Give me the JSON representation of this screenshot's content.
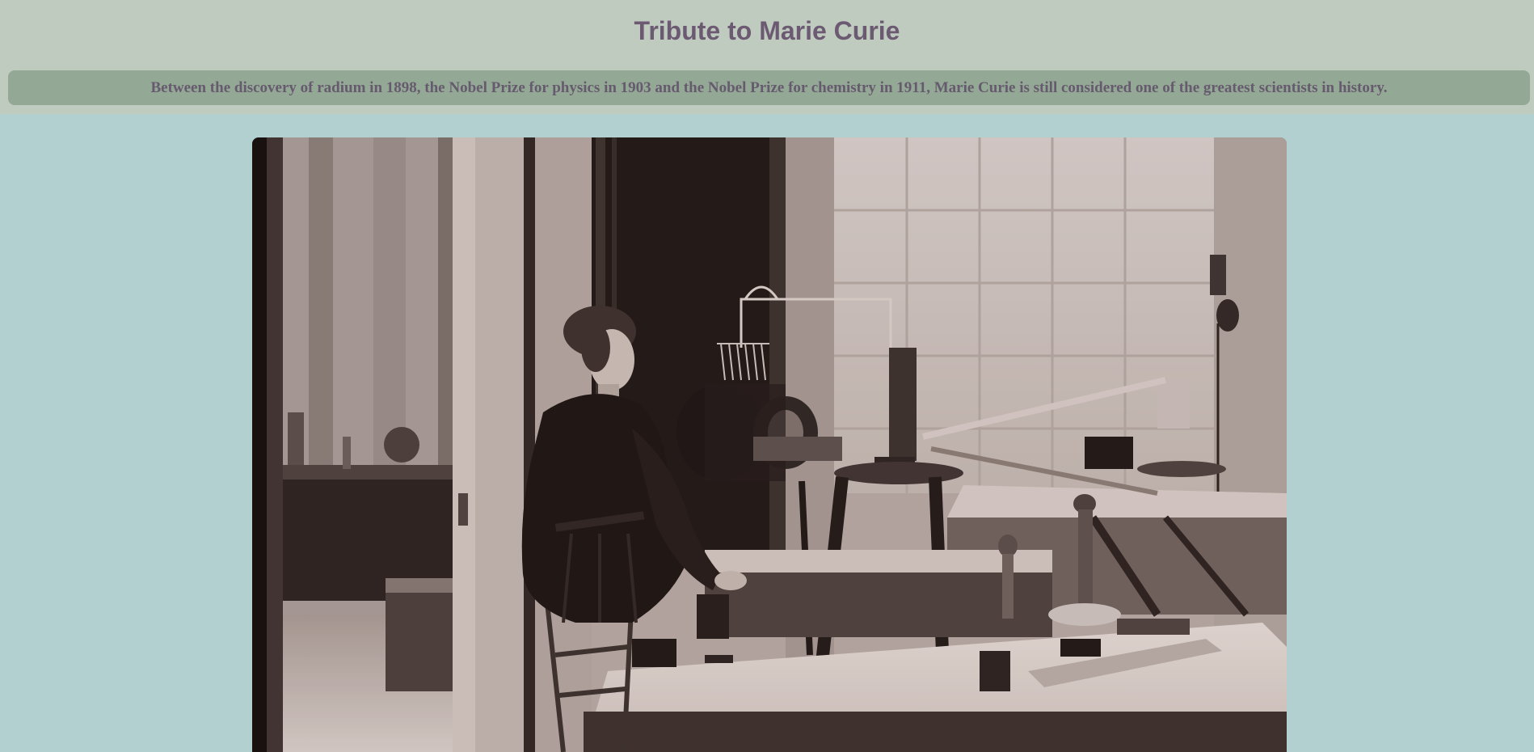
{
  "page": {
    "title": "Tribute to Marie Curie",
    "subtitle": "Between the discovery of radium in 1898, the Nobel Prize for physics in 1903 and the Nobel Prize for chemistry in 1911, Marie Curie is still considered one of the greatest scientists in history."
  },
  "image": {
    "description_icon": "photo-icon"
  },
  "colors": {
    "page_background": "#b1d0cf",
    "header_background": "#c0cbc0",
    "subtitle_bar": "#94a995",
    "title_text": "#6c5a72",
    "subtitle_text": "#665a6e"
  }
}
